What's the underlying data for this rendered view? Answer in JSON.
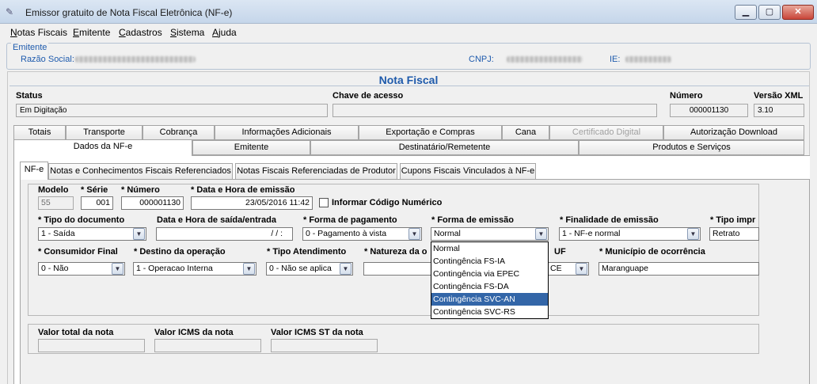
{
  "window": {
    "title": "Emissor gratuito de Nota Fiscal Eletrônica (NF-e)",
    "minimize": "▁",
    "maximize": "▢",
    "close": "✕"
  },
  "menu": [
    "Notas Fiscais",
    "Emitente",
    "Cadastros",
    "Sistema",
    "Ajuda"
  ],
  "emitente": {
    "legend": "Emitente",
    "razao_label": "Razão Social:",
    "cnpj_label": "CNPJ:",
    "ie_label": "IE:"
  },
  "nota": {
    "title": "Nota Fiscal",
    "status_label": "Status",
    "status_value": "Em Digitação",
    "chave_label": "Chave de acesso",
    "chave_value": "",
    "numero_label": "Número",
    "numero_value": "000001130",
    "versao_label": "Versão XML",
    "versao_value": "3.10"
  },
  "tabs_row1": [
    "Totais",
    "Transporte",
    "Cobrança",
    "Informações Adicionais",
    "Exportação e Compras",
    "Cana",
    "Certificado Digital",
    "Autorização Download"
  ],
  "tabs_row2": [
    "Dados da NF-e",
    "Emitente",
    "Destinatário/Remetente",
    "Produtos e Serviços"
  ],
  "subtabs": [
    "NF-e",
    "Notas e Conhecimentos Fiscais Referenciados",
    "Notas Fiscais Referenciadas de Produtor",
    "Cupons Fiscais Vinculados à NF-e"
  ],
  "form": {
    "modelo_label": "Modelo",
    "modelo_value": "55",
    "serie_label": "* Série",
    "serie_value": "001",
    "numero_label": "* Número",
    "numero_value": "000001130",
    "data_emissao_label": "* Data e Hora de emissão",
    "data_emissao_value": "23/05/2016 11:42",
    "codigo_numerico_label": "Informar Código Numérico",
    "tipo_doc_label": "* Tipo do documento",
    "tipo_doc_value": "1 - Saída",
    "data_saida_label": "Data e Hora de saída/entrada",
    "data_saida_value": "/   /      :",
    "forma_pag_label": "* Forma de pagamento",
    "forma_pag_value": "0 - Pagamento à vista",
    "forma_emissao_label": "* Forma de emissão",
    "forma_emissao_value": "Normal",
    "finalidade_label": "* Finalidade de emissão",
    "finalidade_value": "1 - NF-e normal",
    "tipo_impr_label": "* Tipo impr",
    "tipo_impr_value": "Retrato",
    "consumidor_label": "* Consumidor Final",
    "consumidor_value": "0 - Não",
    "destino_label": "* Destino da operação",
    "destino_value": "1 - Operacao Interna",
    "atendimento_label": "* Tipo Atendimento",
    "atendimento_value": "0 - Não se aplica",
    "natureza_label": "* Natureza da o",
    "natureza_value": "",
    "uf_label": "UF",
    "uf_value": "CE",
    "municipio_label": "* Município de ocorrência",
    "municipio_value": "Maranguape",
    "valor_total_label": "Valor total da nota",
    "valor_icms_label": "Valor ICMS da nota",
    "valor_icms_st_label": "Valor ICMS ST da nota"
  },
  "dropdown": {
    "options": [
      "Normal",
      "Contingência FS-IA",
      "Contingência via EPEC",
      "Contingência FS-DA",
      "Contingência SVC-AN",
      "Contingência SVC-RS"
    ],
    "selected": "Contingência SVC-AN"
  },
  "colors": {
    "accent": "#1e5aab",
    "selection": "#3366a8"
  }
}
